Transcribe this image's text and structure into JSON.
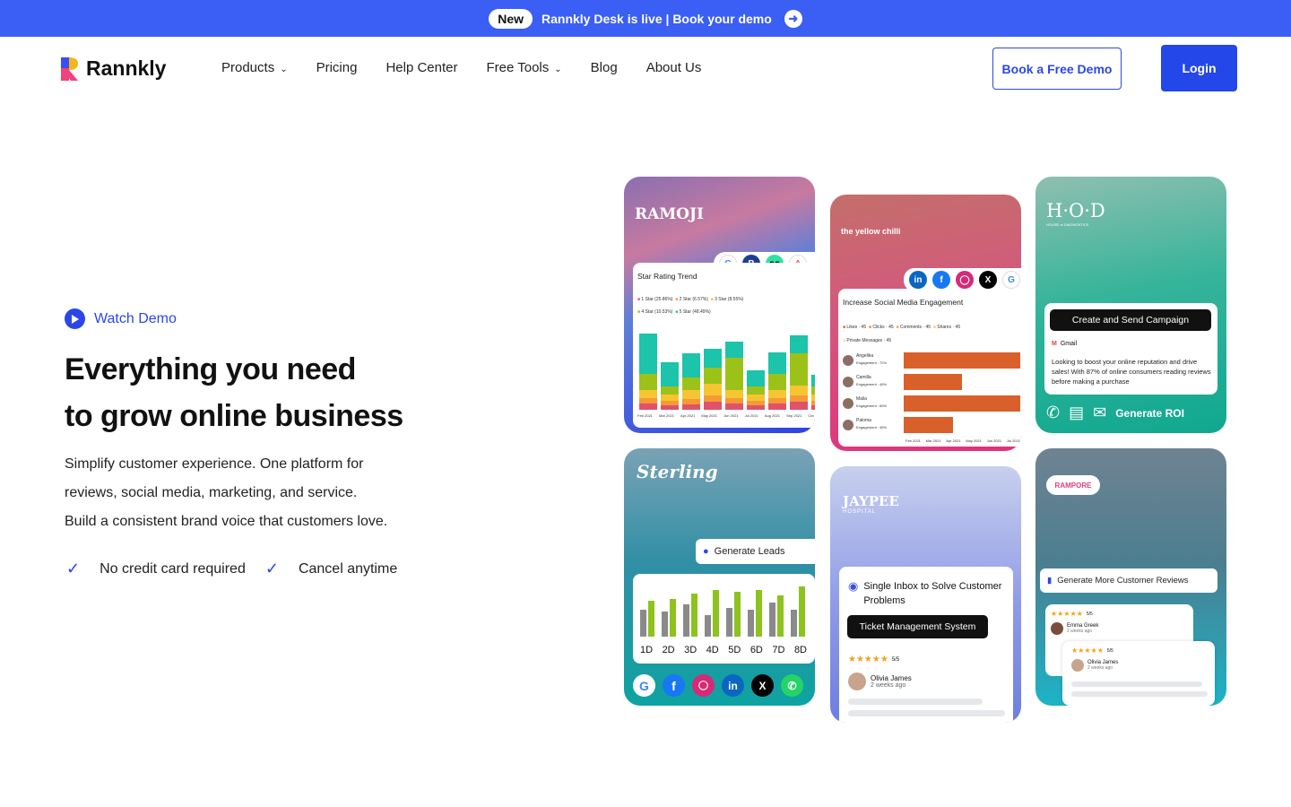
{
  "banner": {
    "pill": "New",
    "text": "Rannkly Desk is live | Book your demo"
  },
  "nav": {
    "logo": "Rannkly",
    "items": [
      "Products",
      "Pricing",
      "Help Center",
      "Free Tools",
      "Blog",
      "About Us"
    ],
    "book_demo": "Book a Free Demo",
    "login": "Login"
  },
  "hero": {
    "watch_demo": "Watch Demo",
    "title_line1": "Everything you need",
    "title_line2": "to grow online business",
    "sub1": "Simplify customer experience. One platform for",
    "sub2": "reviews, social media, marketing, and service.",
    "sub3": "Build a consistent brand voice that customers love.",
    "check1": "No credit card required",
    "check2": "Cancel anytime"
  },
  "cards": {
    "c1": {
      "brand": "RAMOJI",
      "panel_title": "Star Rating Trend",
      "legend1": "1 Star (25.86%)",
      "legend2": "2 Star (6.57%)",
      "legend3": "3 Star (8.55%)",
      "legend4": "4 Star (10.53%)",
      "legend5": "5 Star (48.49%)",
      "months": [
        "Feb 2021",
        "Mar 2021",
        "Apr 2021",
        "May 2021",
        "Jun 2021",
        "Jul 2021",
        "Aug 2021",
        "Sep 2021",
        "Oct 2"
      ]
    },
    "c2": {
      "brand": "the yellow chilli",
      "panel_title": "Increase Social Media Engagement",
      "l1": "Likes · 45",
      "l2": "Clicks · 45",
      "l3": "Comments · 45",
      "l4": "Shares · 45",
      "l5": "Private Messages · 45",
      "people": [
        {
          "name": "Angelika",
          "eng": "Engagement : 72%"
        },
        {
          "name": "Camilla",
          "eng": "Engagement : 45%"
        },
        {
          "name": "Malia",
          "eng": "Engagement : 65%"
        },
        {
          "name": "Paloma",
          "eng": "Engagement : 45%"
        }
      ],
      "months": [
        "Feb 2021",
        "Mar 2021",
        "Apr 2021",
        "May 2021",
        "Jun 2021",
        "Jul 2021"
      ]
    },
    "c3": {
      "brand": "H·O·D",
      "brand_sub": "HOUSE of DIAGNOSTICS",
      "btn": "Create and Send Campaign",
      "gmail": "Gmail",
      "body": "Looking to boost your online reputation and drive sales! With 87% of online consumers reading reviews before making a purchase",
      "roi": "Generate ROI"
    },
    "c4": {
      "brand": "Sterling",
      "tag": "Generate Leads",
      "days": [
        "1D",
        "2D",
        "3D",
        "4D",
        "5D",
        "6D",
        "7D",
        "8D"
      ]
    },
    "c5": {
      "brand": "JAYPEE",
      "brand_sub": "HOSPITAL",
      "inbox": "Single Inbox to Solve Customer Problems",
      "btn": "Ticket Management System",
      "rating": "5/5",
      "name": "Olivia James",
      "time": "2 weeks ago"
    },
    "c6": {
      "brand": "RAMPORE",
      "tag": "Generate More Customer Reviews",
      "r1_rating": "5/5",
      "r1_name": "Emma Greek",
      "r1_time": "2 weeks ago",
      "r2_rating": "5/5",
      "r2_name": "Olivia James",
      "r2_time": "2 weeks ago"
    }
  },
  "colors": {
    "accent": "#2b46e8",
    "banner": "#3b5ef5"
  }
}
